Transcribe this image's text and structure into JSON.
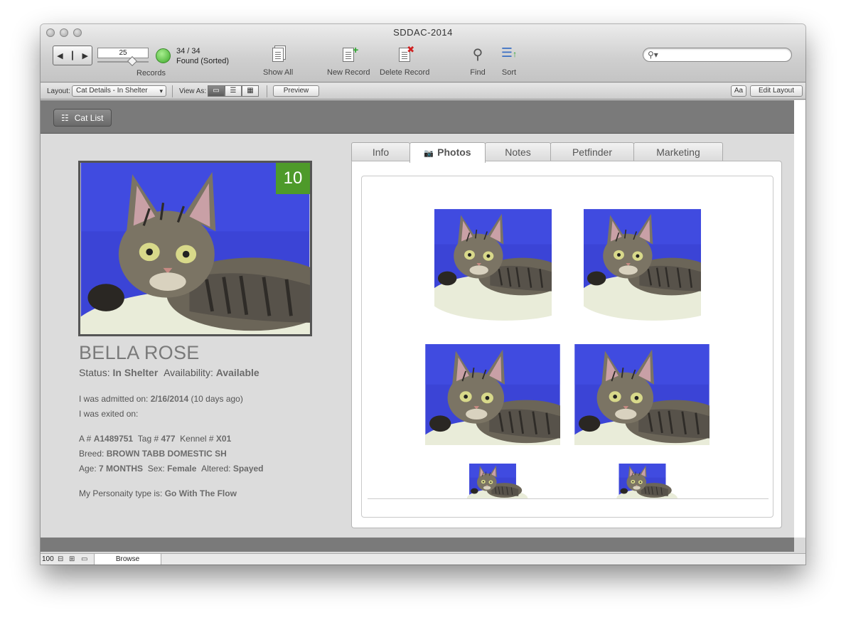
{
  "window": {
    "title": "SDDAC-2014"
  },
  "toolbar": {
    "record_number": "25",
    "records_label": "Records",
    "found_count": "34 / 34",
    "found_status": "Found (Sorted)",
    "show_all_label": "Show All",
    "new_record_label": "New Record",
    "delete_record_label": "Delete Record",
    "find_label": "Find",
    "sort_label": "Sort",
    "search_placeholder": ""
  },
  "layout_bar": {
    "layout_label": "Layout:",
    "layout_value": "Cat Details - In Shelter",
    "view_as_label": "View As:",
    "preview_label": "Preview",
    "font_button_label": "Aa",
    "edit_layout_label": "Edit Layout"
  },
  "header": {
    "cat_list_label": "Cat List"
  },
  "cat": {
    "badge": "10",
    "name": "BELLA ROSE",
    "status_label": "Status:",
    "status": "In Shelter",
    "availability_label": "Availability:",
    "availability": "Available",
    "admitted_label": "I was admitted on:",
    "admitted_date": "2/16/2014",
    "admitted_ago": "(10 days ago)",
    "exited_label": "I was exited on:",
    "a_label": "A #",
    "a_number": "A1489751",
    "tag_label": "Tag #",
    "tag_number": "477",
    "kennel_label": "Kennel #",
    "kennel": "X01",
    "breed_label": "Breed:",
    "breed": "BROWN TABB DOMESTIC SH",
    "age_label": "Age:",
    "age": "7 MONTHS",
    "sex_label": "Sex:",
    "sex": "Female",
    "altered_label": "Altered:",
    "altered": "Spayed",
    "personality_label": "My Personaity type is:",
    "personality": "Go With The Flow"
  },
  "tabs": [
    {
      "label": "Info"
    },
    {
      "label": "Photos",
      "active": true
    },
    {
      "label": "Notes"
    },
    {
      "label": "Petfinder"
    },
    {
      "label": "Marketing"
    }
  ],
  "status_bar": {
    "zoom": "100",
    "mode": "Browse"
  },
  "colors": {
    "badge_green": "#4e9a2a",
    "photo_blue": "#3a45d8",
    "header_gray": "#7a7a7a"
  }
}
